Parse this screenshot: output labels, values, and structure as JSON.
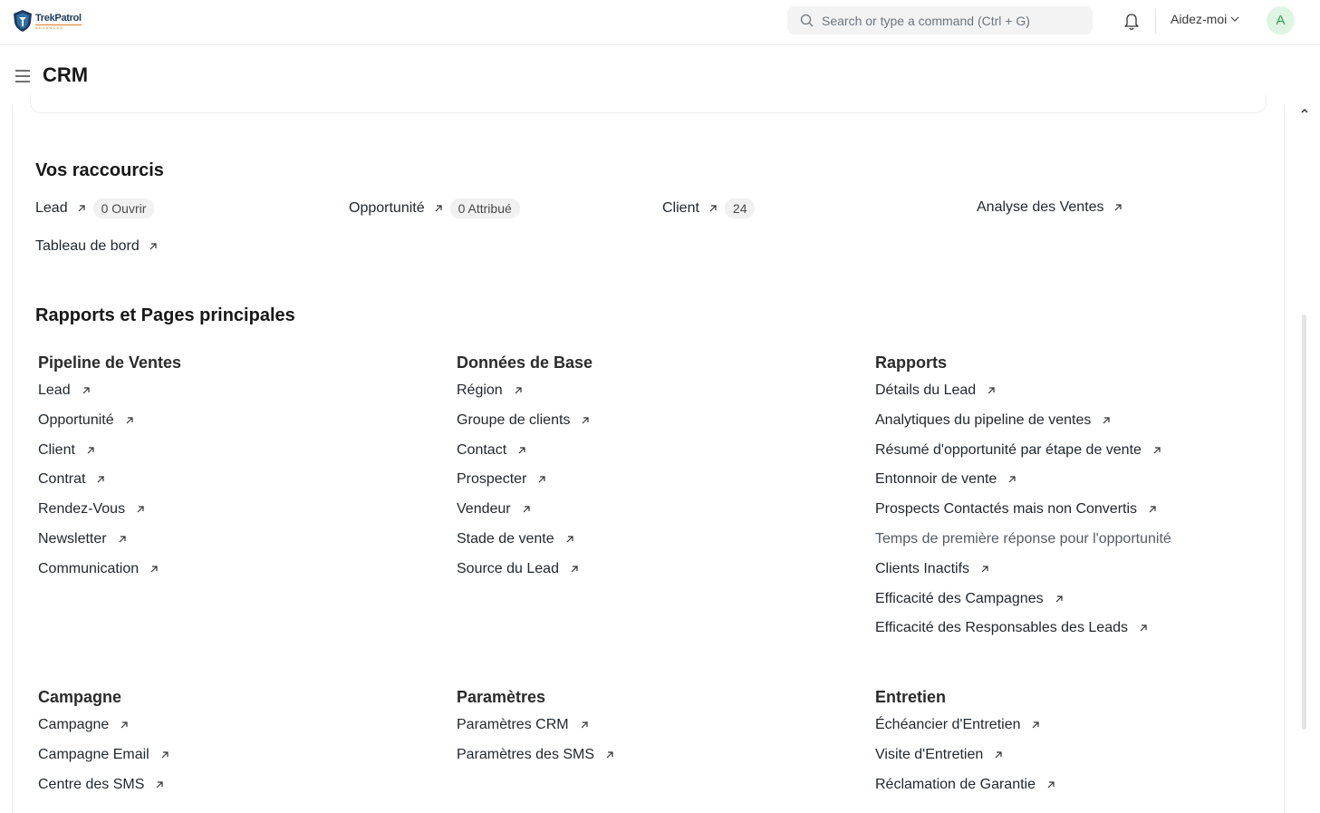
{
  "navbar": {
    "logo_name": "TrekPatrol",
    "logo_sub": "ADVANCED",
    "search_placeholder": "Search or type a command (Ctrl + G)",
    "help_label": "Aidez-moi",
    "avatar_initial": "A"
  },
  "page": {
    "title": "CRM"
  },
  "shortcuts": {
    "title": "Vos raccourcis",
    "items": [
      {
        "label": "Lead",
        "badge": "0 Ouvrir"
      },
      {
        "label": "Opportunité",
        "badge": "0 Attribué"
      },
      {
        "label": "Client",
        "badge": "24"
      },
      {
        "label": "Analyse des Ventes"
      },
      {
        "label": "Tableau de bord"
      }
    ]
  },
  "reports": {
    "title": "Rapports et Pages principales",
    "columns": [
      {
        "title": "Pipeline de Ventes",
        "links": [
          "Lead",
          "Opportunité",
          "Client",
          "Contrat",
          "Rendez-Vous",
          "Newsletter",
          "Communication"
        ]
      },
      {
        "title": "Données de Base",
        "links": [
          "Région",
          "Groupe de clients",
          "Contact",
          "Prospecter",
          "Vendeur",
          "Stade de vente",
          "Source du Lead"
        ]
      },
      {
        "title": "Rapports",
        "links": [
          "Détails du Lead",
          "Analytiques du pipeline de ventes",
          "Résumé d'opportunité par étape de vente",
          "Entonnoir de vente",
          "Prospects Contactés mais non Convertis",
          "Temps de première réponse pour l'opportunité",
          "Clients Inactifs",
          "Efficacité des Campagnes",
          "Efficacité des Responsables des Leads"
        ]
      },
      {
        "title": "Campagne",
        "links": [
          "Campagne",
          "Campagne Email",
          "Centre des SMS"
        ]
      },
      {
        "title": "Paramètres",
        "links": [
          "Paramètres CRM",
          "Paramètres des SMS"
        ]
      },
      {
        "title": "Entretien",
        "links": [
          "Échéancier d'Entretien",
          "Visite d'Entretien",
          "Réclamation de Garantie"
        ]
      }
    ]
  },
  "colors": {
    "accent": "#1e3a5f",
    "logo_orange": "#e07b2a",
    "avatar_bg": "#dff5e4",
    "avatar_fg": "#30a14e"
  }
}
